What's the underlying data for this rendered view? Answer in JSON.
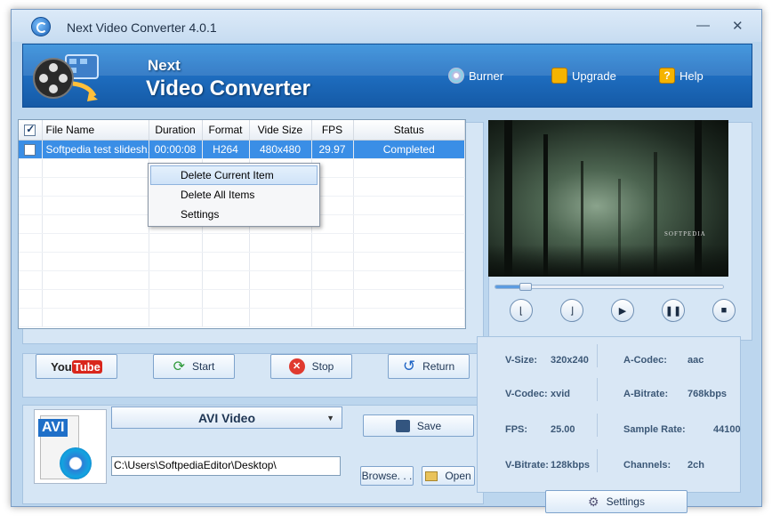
{
  "window": {
    "title": "Next Video Converter 4.0.1",
    "minimize": "—",
    "close": "✕"
  },
  "header": {
    "brand_line1": "Next",
    "brand_line2": "Video Converter",
    "nav": [
      {
        "label": "Burner",
        "icon": "disc-icon"
      },
      {
        "label": "Upgrade",
        "icon": "upgrade-icon"
      },
      {
        "label": "Help",
        "icon": "help-icon"
      }
    ]
  },
  "file_list": {
    "columns": [
      "File Name",
      "Duration",
      "Format",
      "Vide Size",
      "FPS",
      "Status"
    ],
    "rows": [
      {
        "name": "Softpedia test slidesh...",
        "duration": "00:00:08",
        "format": "H264",
        "size": "480x480",
        "fps": "29.97",
        "status": "Completed"
      }
    ]
  },
  "context_menu": {
    "items": [
      "Delete Current Item",
      "Delete All Items",
      "Settings"
    ]
  },
  "actions": {
    "youtube": "YouTube",
    "start": "Start",
    "stop": "Stop",
    "return": "Return"
  },
  "output": {
    "format_icon_text": "AVI",
    "format": "AVI Video",
    "save": "Save",
    "path": "C:\\Users\\SoftpediaEditor\\Desktop\\",
    "browse": "Browse. . .",
    "open": "Open"
  },
  "preview": {
    "watermark": "SOFTPEDIA",
    "progress": 0.12
  },
  "info": {
    "left": [
      {
        "key": "V-Size:",
        "value": "320x240"
      },
      {
        "key": "V-Codec:",
        "value": "xvid"
      },
      {
        "key": "FPS:",
        "value": "25.00"
      },
      {
        "key": "V-Bitrate:",
        "value": "128kbps"
      }
    ],
    "right": [
      {
        "key": "A-Codec:",
        "value": "aac"
      },
      {
        "key": "A-Bitrate:",
        "value": "768kbps"
      },
      {
        "key": "Sample Rate:",
        "value": "44100"
      },
      {
        "key": "Channels:",
        "value": "2ch"
      }
    ],
    "settings": "Settings"
  }
}
